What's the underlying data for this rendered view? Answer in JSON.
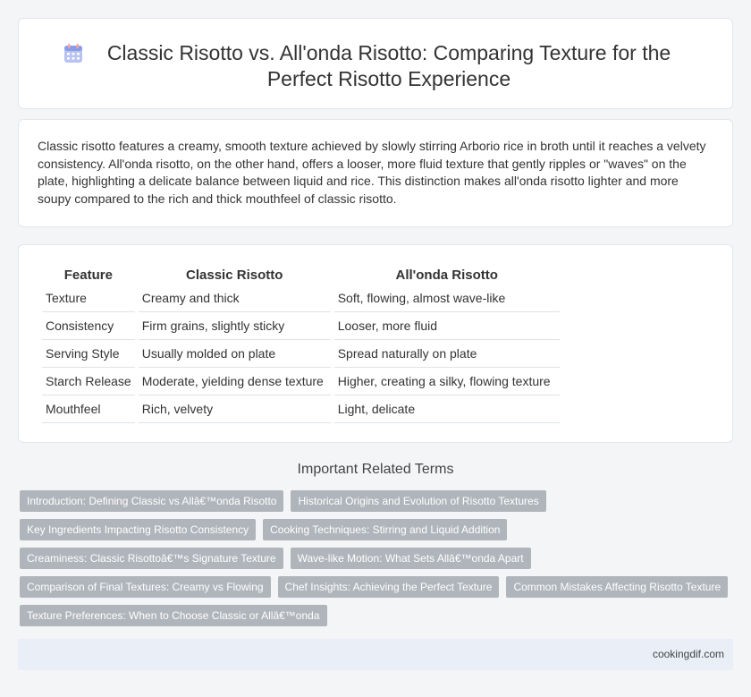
{
  "header": {
    "title": "Classic Risotto vs. All'onda Risotto: Comparing Texture for the Perfect Risotto Experience",
    "icon": "calendar-icon"
  },
  "intro": {
    "text": "Classic risotto features a creamy, smooth texture achieved by slowly stirring Arborio rice in broth until it reaches a velvety consistency. All'onda risotto, on the other hand, offers a looser, more fluid texture that gently ripples or \"waves\" on the plate, highlighting a delicate balance between liquid and rice. This distinction makes all'onda risotto lighter and more soupy compared to the rich and thick mouthfeel of classic risotto."
  },
  "table": {
    "headers": [
      "Feature",
      "Classic Risotto",
      "All'onda Risotto"
    ],
    "rows": [
      [
        "Texture",
        "Creamy and thick",
        "Soft, flowing, almost wave-like"
      ],
      [
        "Consistency",
        "Firm grains, slightly sticky",
        "Looser, more fluid"
      ],
      [
        "Serving Style",
        "Usually molded on plate",
        "Spread naturally on plate"
      ],
      [
        "Starch Release",
        "Moderate, yielding dense texture",
        "Higher, creating a silky, flowing texture"
      ],
      [
        "Mouthfeel",
        "Rich, velvety",
        "Light, delicate"
      ]
    ]
  },
  "related": {
    "title": "Important Related Terms",
    "rows": [
      [
        "Introduction: Defining Classic vs Allâ€™onda Risotto",
        "Historical Origins and Evolution of Risotto Textures"
      ],
      [
        "Key Ingredients Impacting Risotto Consistency",
        "Cooking Techniques: Stirring and Liquid Addition"
      ],
      [
        "Creaminess: Classic Risottoâ€™s Signature Texture",
        "Wave-like Motion: What Sets Allâ€™onda Apart"
      ],
      [
        "Comparison of Final Textures: Creamy vs Flowing",
        "Chef Insights: Achieving the Perfect Texture",
        "Common Mistakes Affecting Risotto Texture"
      ],
      [
        "Texture Preferences: When to Choose Classic or Allâ€™onda"
      ]
    ]
  },
  "footer": {
    "site": "cookingdif.com"
  }
}
